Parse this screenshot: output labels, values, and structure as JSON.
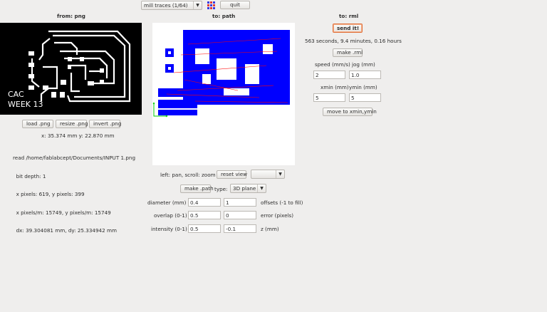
{
  "toolbar": {
    "process_combo": "mill traces (1/64)",
    "palette_icon": "color-grid-icon",
    "quit_label": "quit"
  },
  "left_panel": {
    "header": "from: png",
    "image_text_line1": "CAC",
    "image_text_line2": "WEEK 13",
    "load_label": "load .png",
    "resize_label": "resize .png",
    "invert_label": "invert .png",
    "coords": "x: 35.374 mm  y: 22.870 mm",
    "info_lines": [
      "read /home/fablabcept/Documents/INPUT 1.png",
      "  bit depth: 1",
      "  x pixels: 619, y pixels: 399",
      "  x pixels/m: 15749, y pixels/m: 15749",
      "  dx: 39.304081 mm, dy: 25.334942 mm"
    ]
  },
  "middle_panel": {
    "header": "to: path",
    "view_hint": "left: pan, scroll: zoom",
    "reset_view_label": "reset view",
    "view_combo": "",
    "make_path_label": "make .path",
    "type_label": "type:",
    "type_combo": "3D plane",
    "params": [
      {
        "label": "diameter (mm)",
        "value": "0.4",
        "value2": "1",
        "label2": "offsets (-1 to fill)"
      },
      {
        "label": "overlap (0-1)",
        "value": "0.5",
        "value2": "0",
        "label2": "error (pixels)"
      },
      {
        "label": "intensity (0-1)",
        "value": "0.5",
        "value2": "-0.1",
        "label2": "z (mm)"
      }
    ]
  },
  "right_panel": {
    "header": "to: rml",
    "send_label": "send it!",
    "estimate": "563 seconds, 9.4 minutes, 0.16 hours",
    "make_rml_label": "make .rml",
    "speed_label": "speed (mm/s)",
    "jog_label": "jog (mm)",
    "speed_value": "2",
    "jog_value": "1.0",
    "xmin_label": "xmin (mm)",
    "ymin_label": "ymin (mm)",
    "xmin_value": "5",
    "ymin_value": "5",
    "move_label": "move to xmin,ymin"
  },
  "colors": {
    "path_blue": "#0000ff",
    "path_red": "#ff0000",
    "axis_green": "#00cc00",
    "send_border": "#e0703a"
  }
}
